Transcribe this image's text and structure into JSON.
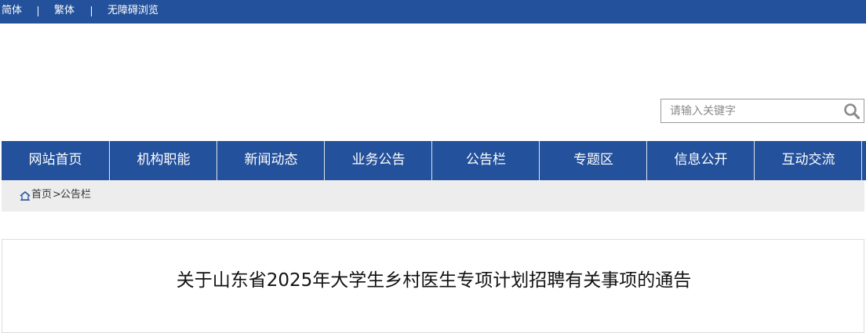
{
  "topbar": {
    "simplified": "简体",
    "traditional": "繁体",
    "accessibility": "无障碍浏览"
  },
  "search": {
    "placeholder": "请输入关键字",
    "value": "",
    "icon": "search-icon"
  },
  "nav": {
    "items": [
      {
        "label": "网站首页"
      },
      {
        "label": "机构职能"
      },
      {
        "label": "新闻动态"
      },
      {
        "label": "业务公告"
      },
      {
        "label": "公告栏"
      },
      {
        "label": "专题区"
      },
      {
        "label": "信息公开"
      },
      {
        "label": "互动交流"
      }
    ]
  },
  "breadcrumb": {
    "icon": "home-icon",
    "home": "首页",
    "separator": ">",
    "current": "公告栏"
  },
  "article": {
    "title": "关于山东省2025年大学生乡村医生专项计划招聘有关事项的通告"
  },
  "colors": {
    "primary": "#23519b",
    "breadcrumb_bg": "#ededed",
    "border": "#dcdcdc"
  }
}
